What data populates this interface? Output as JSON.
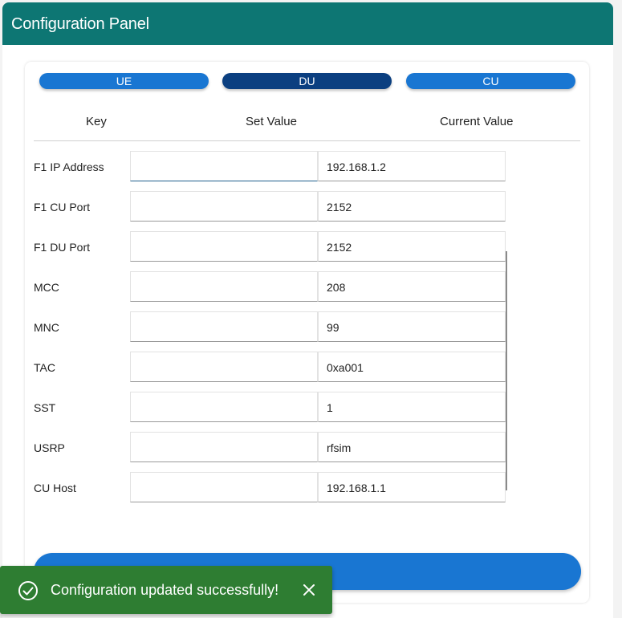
{
  "header": {
    "title": "Configuration Panel"
  },
  "tabs": [
    {
      "label": "UE",
      "active": false
    },
    {
      "label": "DU",
      "active": true
    },
    {
      "label": "CU",
      "active": false
    }
  ],
  "table": {
    "columns": {
      "key": "Key",
      "set_value": "Set Value",
      "current_value": "Current Value"
    },
    "rows": [
      {
        "key": "F1 IP Address",
        "set_value": "",
        "current_value": "192.168.1.2"
      },
      {
        "key": "F1 CU Port",
        "set_value": "",
        "current_value": "2152"
      },
      {
        "key": "F1 DU Port",
        "set_value": "",
        "current_value": "2152"
      },
      {
        "key": "MCC",
        "set_value": "",
        "current_value": "208"
      },
      {
        "key": "MNC",
        "set_value": "",
        "current_value": "99"
      },
      {
        "key": "TAC",
        "set_value": "",
        "current_value": "0xa001"
      },
      {
        "key": "SST",
        "set_value": "",
        "current_value": "1"
      },
      {
        "key": "USRP",
        "set_value": "",
        "current_value": "rfsim"
      },
      {
        "key": "CU Host",
        "set_value": "",
        "current_value": "192.168.1.1"
      }
    ]
  },
  "toast": {
    "message": "Configuration updated successfully!",
    "icon": "check-circle-icon",
    "close_icon": "close-icon"
  },
  "colors": {
    "header": "#0d7673",
    "tab_active": "#0b3f80",
    "tab_inactive": "#1976d2",
    "submit": "#1976d2",
    "toast": "#2e7d32"
  }
}
